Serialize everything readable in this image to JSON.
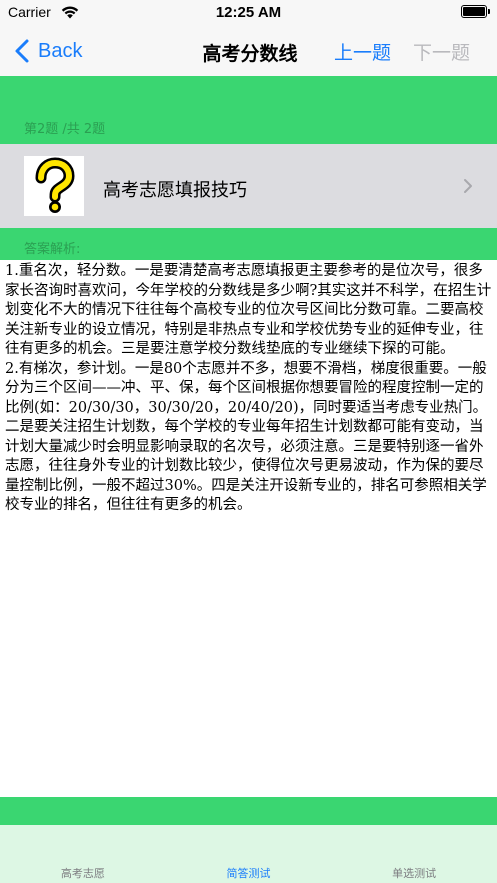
{
  "status_bar": {
    "carrier": "Carrier",
    "time": "12:25 AM",
    "wifi_icon": "wifi-icon",
    "battery_icon": "battery-full-icon"
  },
  "nav": {
    "back_label": "Back",
    "title": "高考分数线",
    "prev_label": "上一题",
    "next_label": "下一题",
    "accent_color": "#1a7dfb",
    "disabled_color": "#b9b9bd"
  },
  "question": {
    "counter": "第2题 /共 2题",
    "title": "高考志愿填报技巧",
    "icon": "question-mark-icon"
  },
  "answer": {
    "label": "答案解析:",
    "text": "1.重名次，轻分数。一是要清楚高考志愿填报更主要参考的是位次号，很多家长咨询时喜欢问，今年学校的分数线是多少啊?其实这并不科学，在招生计划变化不大的情况下往往每个高校专业的位次号区间比分数可靠。二要高校关注新专业的设立情况，特别是非热点专业和学校优势专业的延伸专业，往往有更多的机会。三是要注意学校分数线垫底的专业继续下探的可能。      2.有梯次，参计划。一是80个志愿并不多，想要不滑档，梯度很重要。一般分为三个区间——冲、平、保，每个区间根据你想要冒险的程度控制一定的比例(如：20/30/30，30/30/20，20/40/20)，同时要适当考虑专业热门。二是要关注招生计划数，每个学校的专业每年招生计划数都可能有变动，当计划大量减少时会明显影响录取的名次号，必须注意。三是要特别逐一省外志愿，往往身外专业的计划数比较少，使得位次号更易波动，作为保的要尽量控制比例，一般不超过30%。四是关注开设新专业的，排名可参照相关学校专业的排名，但往往有更多的机会。"
  },
  "tabs": [
    {
      "label": "高考志愿",
      "active": false
    },
    {
      "label": "简答测试",
      "active": true
    },
    {
      "label": "单选测试",
      "active": false
    }
  ],
  "colors": {
    "green": "#3ad671",
    "green_text": "#2b9f52",
    "row_gray": "#dcdce0",
    "tab_bar_bg": "#ddf7e4"
  }
}
